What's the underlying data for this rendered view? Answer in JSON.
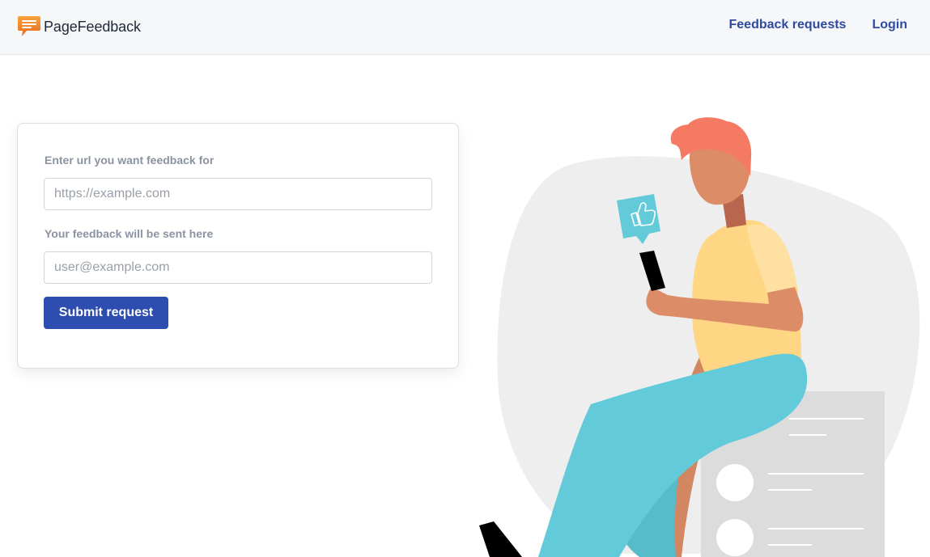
{
  "brand": {
    "name": "PageFeedback",
    "icon": "chat-bubble-logo-icon",
    "color": "#f08a24"
  },
  "nav": {
    "feedback_requests": "Feedback requests",
    "login": "Login"
  },
  "form": {
    "url_label": "Enter url you want feedback for",
    "url_placeholder": "https://example.com",
    "url_value": "",
    "email_label": "Your feedback will be sent here",
    "email_placeholder": "user@example.com",
    "email_value": "",
    "submit_label": "Submit request"
  },
  "colors": {
    "accent": "#2e4db0",
    "nav_link": "#2f4a9e",
    "illustration_bg": "#eeeeee",
    "hair": "#f47a64",
    "shirt": "#ffd683",
    "pants": "#62cad9",
    "skin": "#dc8d68"
  },
  "illustration": {
    "icon": "thumbs-up-icon"
  }
}
